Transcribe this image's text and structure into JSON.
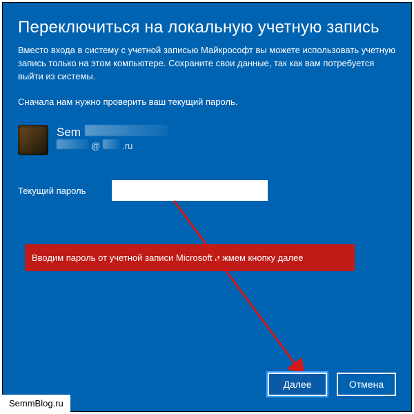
{
  "colors": {
    "bg": "#0063b1",
    "callout": "#c01b17"
  },
  "title": "Переключиться на локальную учетную запись",
  "paragraph1": "Вместо входа в систему с учетной записью Майкрософт вы можете использовать учетную запись только на этом компьютере. Сохраните свои данные, так как вам потребуется выйти из системы.",
  "paragraph2": "Сначала нам нужно проверить ваш текущий пароль.",
  "account": {
    "name_visible": "Sem",
    "email_at": "@",
    "email_domain_fragment": ".ru"
  },
  "form": {
    "password_label": "Текущий пароль",
    "password_value": ""
  },
  "callout_text": "Вводим пароль от учетной записи Microsoft и жмем кнопку далее",
  "buttons": {
    "next": "Далее",
    "cancel": "Отмена"
  },
  "watermark": "SemmBlog.ru"
}
